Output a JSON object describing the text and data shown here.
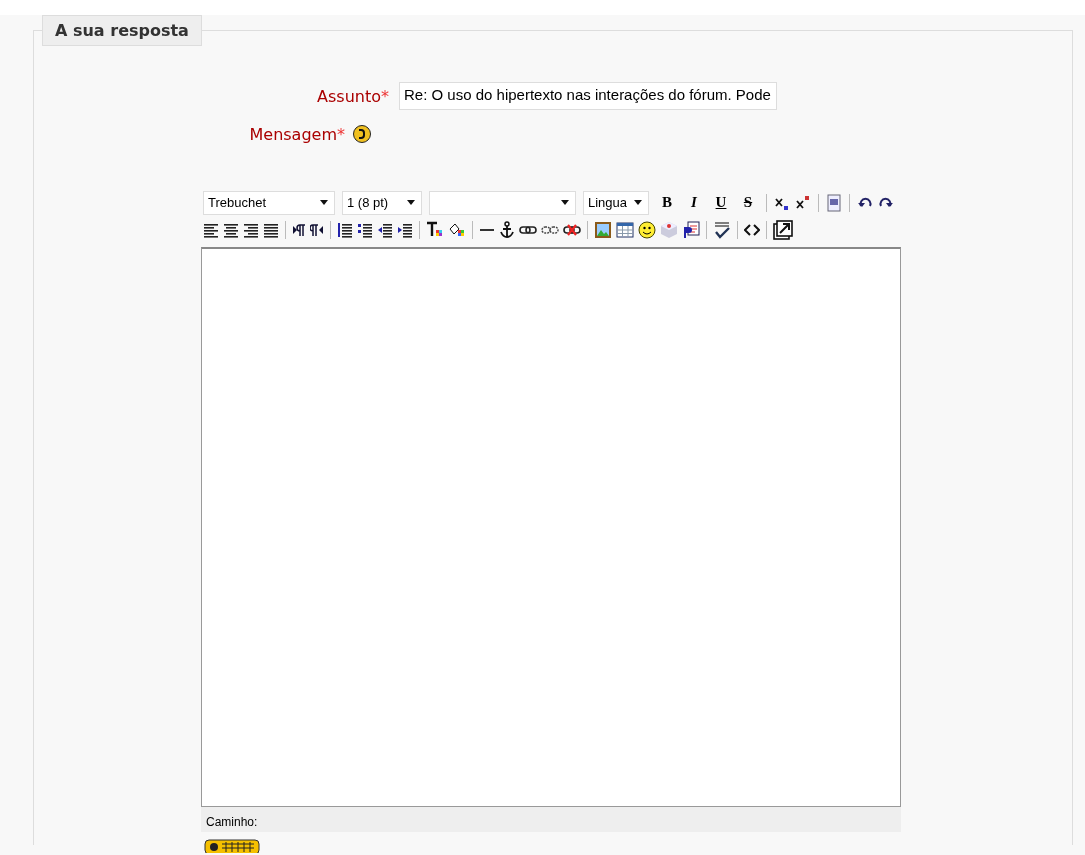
{
  "section": {
    "legend": "A sua resposta"
  },
  "fields": [
    {
      "label": "Assunto",
      "required_mark": "*",
      "value": "Re: O uso do hipertexto nas interações do fórum. Pode"
    },
    {
      "label": "Mensagem",
      "required_mark": "*",
      "help": true
    }
  ],
  "toolbar": {
    "selects": [
      {
        "kind": "text",
        "value": "Trebuchet"
      },
      {
        "kind": "text",
        "value": "1 (8 pt)"
      },
      {
        "kind": "blank"
      },
      {
        "kind": "text",
        "value": "Lingua"
      }
    ],
    "format_buttons": [
      {
        "label": "B",
        "kind": "bold"
      },
      {
        "label": "I",
        "kind": "italic"
      },
      {
        "label": "U",
        "kind": "underline"
      },
      {
        "label": "S",
        "kind": "strike"
      }
    ]
  },
  "editor": {
    "path_label": "Caminho:"
  }
}
